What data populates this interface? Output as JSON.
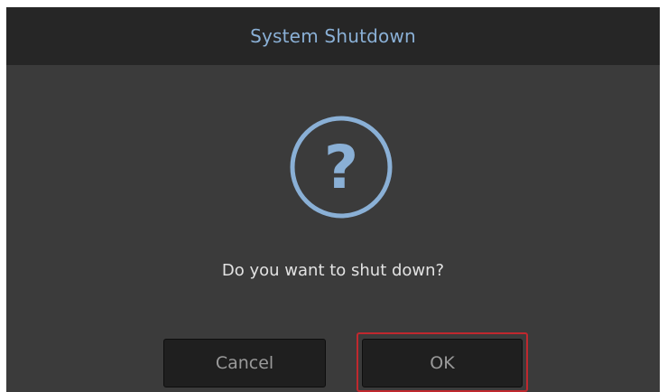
{
  "dialog": {
    "title": "System Shutdown",
    "icon": "question-circle-icon",
    "icon_glyph": "?",
    "message": "Do you want to shut down?",
    "buttons": {
      "cancel_label": "Cancel",
      "ok_label": "OK"
    },
    "focused_button": "OK"
  },
  "colors": {
    "dialog_background": "#3b3b3b",
    "titlebar_background": "#262626",
    "title_text": "#8ab0d6",
    "icon": "#8ab0d6",
    "message_text": "#e2e2e2",
    "button_background": "#1f1f1f",
    "button_text": "#9a9a9a",
    "focus_outline": "#c0282e"
  }
}
